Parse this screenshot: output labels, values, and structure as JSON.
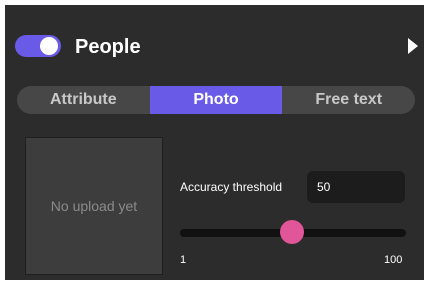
{
  "section": {
    "title": "People",
    "enabled": true
  },
  "tabs": [
    {
      "label": "Attribute",
      "active": false
    },
    {
      "label": "Photo",
      "active": true
    },
    {
      "label": "Free text",
      "active": false
    }
  ],
  "upload": {
    "placeholder": "No upload yet"
  },
  "accuracy": {
    "label": "Accuracy threshold",
    "value": "50",
    "min": 1,
    "max": 100
  },
  "colors": {
    "accent": "#6a5ae8",
    "slider_thumb": "#e05698",
    "panel_bg": "#2c2c2c"
  },
  "icons": {
    "expand": "chevron-right-icon"
  }
}
